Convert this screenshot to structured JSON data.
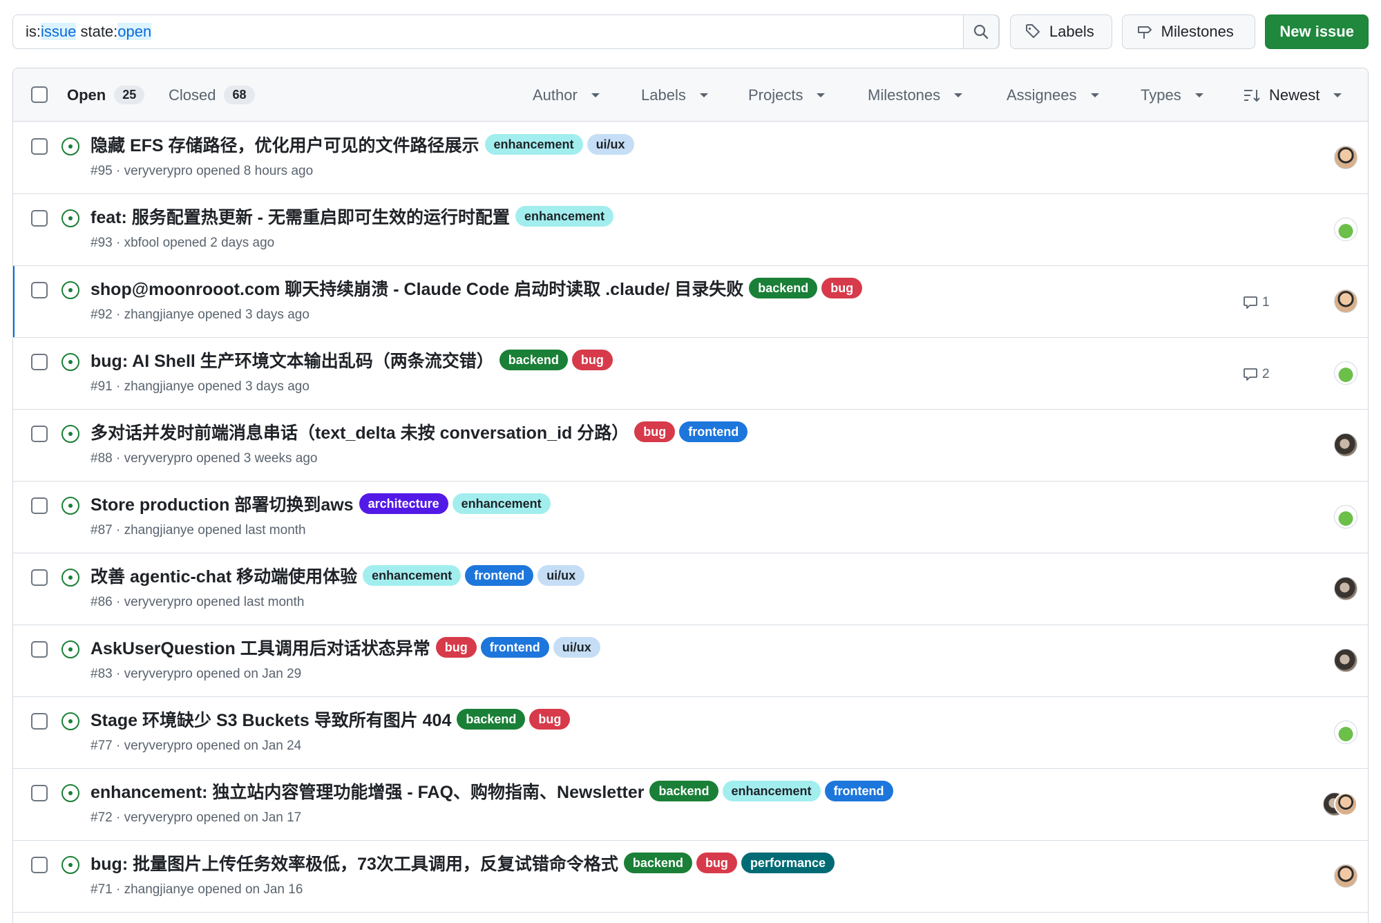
{
  "search": {
    "prefix1": "is:",
    "value1": "issue",
    "mid": " state:",
    "value2": "open"
  },
  "toolbar": {
    "labels_button": "Labels",
    "milestones_button": "Milestones",
    "new_issue_button": "New issue"
  },
  "tabs": {
    "open_label": "Open",
    "open_count": "25",
    "closed_label": "Closed",
    "closed_count": "68"
  },
  "filters": {
    "author": "Author",
    "labels": "Labels",
    "projects": "Projects",
    "milestones": "Milestones",
    "assignees": "Assignees",
    "types": "Types",
    "sort": "Newest"
  },
  "label_colors": {
    "enhancement": {
      "bg": "#a2eeef",
      "fg": "#1f2328"
    },
    "ui/ux": {
      "bg": "#c5def5",
      "fg": "#1f2328"
    },
    "backend": {
      "bg": "#1a7f37",
      "fg": "#ffffff"
    },
    "bug": {
      "bg": "#d73a4a",
      "fg": "#ffffff"
    },
    "frontend": {
      "bg": "#1d76db",
      "fg": "#ffffff"
    },
    "architecture": {
      "bg": "#5319e7",
      "fg": "#ffffff"
    },
    "performance": {
      "bg": "#006b75",
      "fg": "#ffffff"
    }
  },
  "issues": [
    {
      "title": "隐藏 EFS 存储路径，优化用户可见的文件路径展示",
      "labels": [
        "enhancement",
        "ui/ux"
      ],
      "meta": "#95 · veryverypro opened 8 hours ago",
      "comments": "",
      "avatar": "face-icon"
    },
    {
      "title": "feat: 服务配置热更新 - 无需重启即可生效的运行时配置",
      "labels": [
        "enhancement"
      ],
      "meta": "#93 · xbfool opened 2 days ago",
      "comments": "",
      "avatar": "frog-icon"
    },
    {
      "title": "shop@moonrooot.com 聊天持续崩溃 - Claude Code 启动时读取 .claude/ 目录失败",
      "labels": [
        "backend",
        "bug"
      ],
      "meta": "#92 · zhangjianye opened 3 days ago",
      "comments": "1",
      "avatar": "face-icon",
      "active": true
    },
    {
      "title": "bug: AI Shell 生产环境文本输出乱码（两条流交错）",
      "labels": [
        "backend",
        "bug"
      ],
      "meta": "#91 · zhangjianye opened 3 days ago",
      "comments": "2",
      "avatar": "frog-icon"
    },
    {
      "title": "多对话并发时前端消息串话（text_delta 未按 conversation_id 分路）",
      "labels": [
        "bug",
        "frontend"
      ],
      "meta": "#88 · veryverypro opened 3 weeks ago",
      "comments": "",
      "avatar": "dark-icon"
    },
    {
      "title": "Store production 部署切换到aws",
      "labels": [
        "architecture",
        "enhancement"
      ],
      "meta": "#87 · zhangjianye opened last month",
      "comments": "",
      "avatar": "frog-icon"
    },
    {
      "title": "改善 agentic-chat 移动端使用体验",
      "labels": [
        "enhancement",
        "frontend",
        "ui/ux"
      ],
      "meta": "#86 · veryverypro opened last month",
      "comments": "",
      "avatar": "dark-icon"
    },
    {
      "title": "AskUserQuestion 工具调用后对话状态异常",
      "labels": [
        "bug",
        "frontend",
        "ui/ux"
      ],
      "meta": "#83 · veryverypro opened on Jan 29",
      "comments": "",
      "avatar": "dark-icon"
    },
    {
      "title": "Stage 环境缺少 S3 Buckets 导致所有图片 404",
      "labels": [
        "backend",
        "bug"
      ],
      "meta": "#77 · veryverypro opened on Jan 24",
      "comments": "",
      "avatar": "frog-icon"
    },
    {
      "title": "enhancement: 独立站内容管理功能增强 - FAQ、购物指南、Newsletter",
      "labels": [
        "backend",
        "enhancement",
        "frontend"
      ],
      "meta": "#72 · veryverypro opened on Jan 17",
      "comments": "",
      "avatar": "pair-icon"
    },
    {
      "title": "bug: 批量图片上传任务效率极低，73次工具调用，反复试错命令格式",
      "labels": [
        "backend",
        "bug",
        "performance"
      ],
      "meta": "#71 · zhangjianye opened on Jan 16",
      "comments": "",
      "avatar": "face-icon"
    }
  ]
}
